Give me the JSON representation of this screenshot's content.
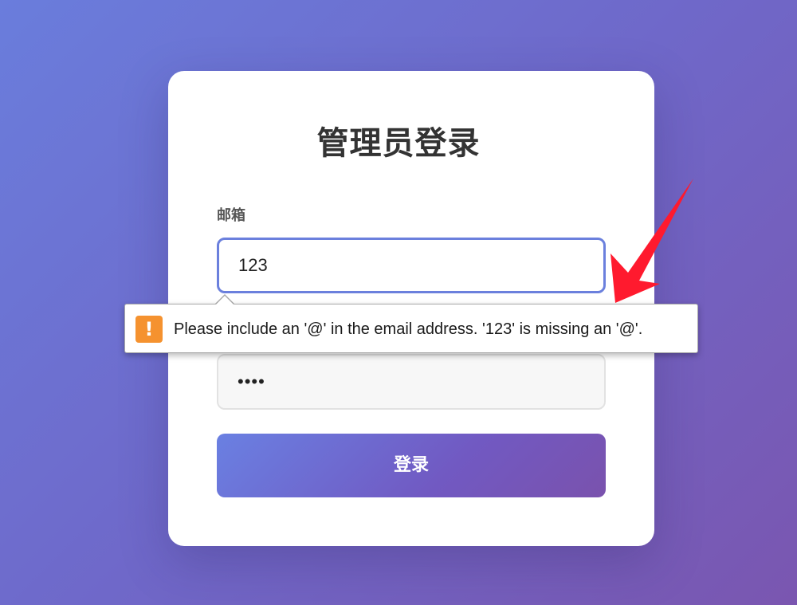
{
  "login": {
    "title": "管理员登录",
    "email_label": "邮箱",
    "email_value": "123",
    "password_value": "••••",
    "submit_label": "登录"
  },
  "validation": {
    "icon": "warning-icon",
    "icon_glyph": "!",
    "message": "Please include an '@' in the email address. '123' is missing an '@'."
  },
  "colors": {
    "accent": "#6b80dd",
    "warning": "#f5922f",
    "annotation_arrow": "#ff1a2e"
  }
}
